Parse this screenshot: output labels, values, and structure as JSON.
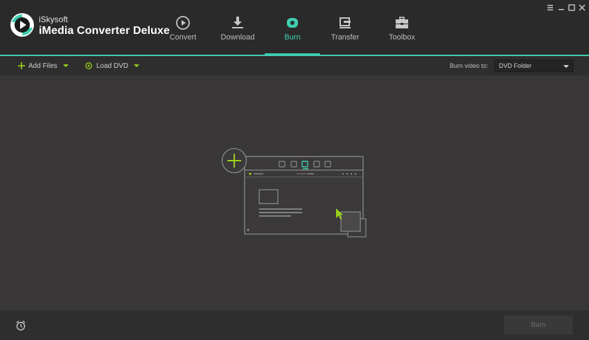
{
  "app": {
    "brand_small": "iSkysoft",
    "brand_name": "iMedia Converter Deluxe"
  },
  "nav": {
    "tabs": [
      {
        "label": "Convert",
        "icon": "convert-icon"
      },
      {
        "label": "Download",
        "icon": "download-icon"
      },
      {
        "label": "Burn",
        "icon": "burn-icon",
        "active": true
      },
      {
        "label": "Transfer",
        "icon": "transfer-icon"
      },
      {
        "label": "Toolbox",
        "icon": "toolbox-icon"
      }
    ]
  },
  "window_controls": [
    "menu-icon",
    "minimize-icon",
    "maximize-icon",
    "close-icon"
  ],
  "toolbar": {
    "add_files_label": "Add Files",
    "load_dvd_label": "Load DVD",
    "burn_to_label": "Burn video to:",
    "burn_to_value": "DVD Folder"
  },
  "bottom": {
    "burn_label": "Burn",
    "alarm_icon": "alarm-clock-icon"
  },
  "colors": {
    "accent": "#3ecfb0",
    "green": "#9bd219",
    "background": "#393737",
    "header": "#2b2a2a"
  }
}
